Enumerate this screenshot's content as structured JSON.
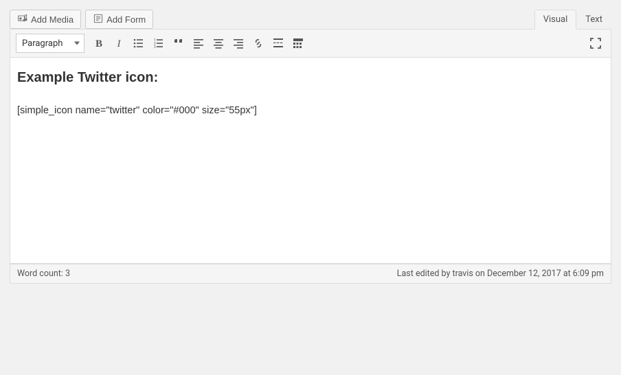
{
  "buttons": {
    "add_media": "Add Media",
    "add_form": "Add Form"
  },
  "tabs": {
    "visual": "Visual",
    "text": "Text"
  },
  "toolbar": {
    "format_selected": "Paragraph"
  },
  "content": {
    "heading": "Example Twitter icon:",
    "body": "[simple_icon name=\"twitter\" color=\"#000\" size=\"55px\"]"
  },
  "status": {
    "word_count_label": "Word count: 3",
    "last_edited": "Last edited by travis on December 12, 2017 at 6:09 pm"
  }
}
